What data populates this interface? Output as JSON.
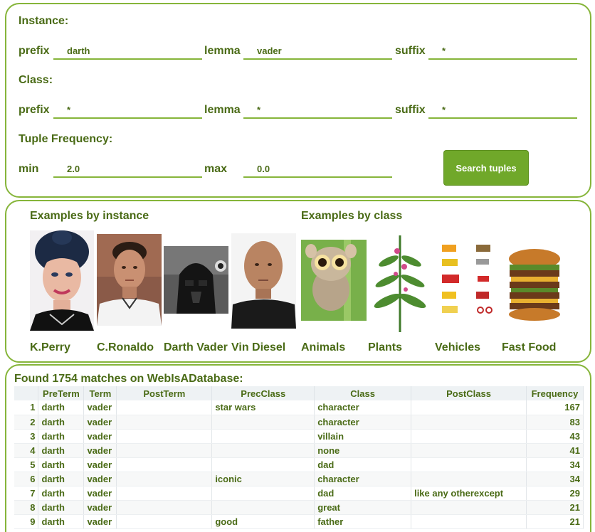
{
  "search": {
    "instance_heading": "Instance:",
    "instance": {
      "prefix_label": "prefix",
      "prefix_value": "darth",
      "lemma_label": "lemma",
      "lemma_value": "vader",
      "suffix_label": "suffix",
      "suffix_value": "*"
    },
    "class_heading": "Class:",
    "class": {
      "prefix_label": "prefix",
      "prefix_value": "*",
      "lemma_label": "lemma",
      "lemma_value": "*",
      "suffix_label": "suffix",
      "suffix_value": "*"
    },
    "frequency_heading": "Tuple Frequency:",
    "frequency": {
      "min_label": "min",
      "min_value": "2.0",
      "max_label": "max",
      "max_value": "0.0"
    },
    "search_button": "Search tuples"
  },
  "examples": {
    "by_instance_title": "Examples by instance",
    "by_class_title": "Examples by class",
    "instances": [
      {
        "caption": "K.Perry",
        "icon": "woman-portrait-icon"
      },
      {
        "caption": "C.Ronaldo",
        "icon": "man-portrait-icon"
      },
      {
        "caption": "Darth Vader",
        "icon": "helmet-icon"
      },
      {
        "caption": "Vin Diesel",
        "icon": "bald-man-icon"
      }
    ],
    "classes": [
      {
        "caption": "Animals",
        "icon": "tarsier-icon"
      },
      {
        "caption": "Plants",
        "icon": "plant-icon"
      },
      {
        "caption": "Vehicles",
        "icon": "vehicles-icon"
      },
      {
        "caption": "Fast Food",
        "icon": "burger-icon"
      }
    ]
  },
  "results": {
    "title": "Found 1754 matches on WebIsADatabase:",
    "columns": [
      "",
      "PreTerm",
      "Term",
      "PostTerm",
      "PrecClass",
      "Class",
      "PostClass",
      "Frequency"
    ],
    "rows": [
      [
        "1",
        "darth",
        "vader",
        "",
        "star wars",
        "character",
        "",
        "167"
      ],
      [
        "2",
        "darth",
        "vader",
        "",
        "",
        "character",
        "",
        "83"
      ],
      [
        "3",
        "darth",
        "vader",
        "",
        "",
        "villain",
        "",
        "43"
      ],
      [
        "4",
        "darth",
        "vader",
        "",
        "",
        "none",
        "",
        "41"
      ],
      [
        "5",
        "darth",
        "vader",
        "",
        "",
        "dad",
        "",
        "34"
      ],
      [
        "6",
        "darth",
        "vader",
        "",
        "iconic",
        "character",
        "",
        "34"
      ],
      [
        "7",
        "darth",
        "vader",
        "",
        "",
        "dad",
        "like any otherexcept",
        "29"
      ],
      [
        "8",
        "darth",
        "vader",
        "",
        "",
        "great",
        "",
        "21"
      ],
      [
        "9",
        "darth",
        "vader",
        "",
        "good",
        "father",
        "",
        "21"
      ]
    ]
  },
  "colors": {
    "accent": "#86b53a",
    "button": "#70a82a",
    "text": "#4a6b16"
  }
}
